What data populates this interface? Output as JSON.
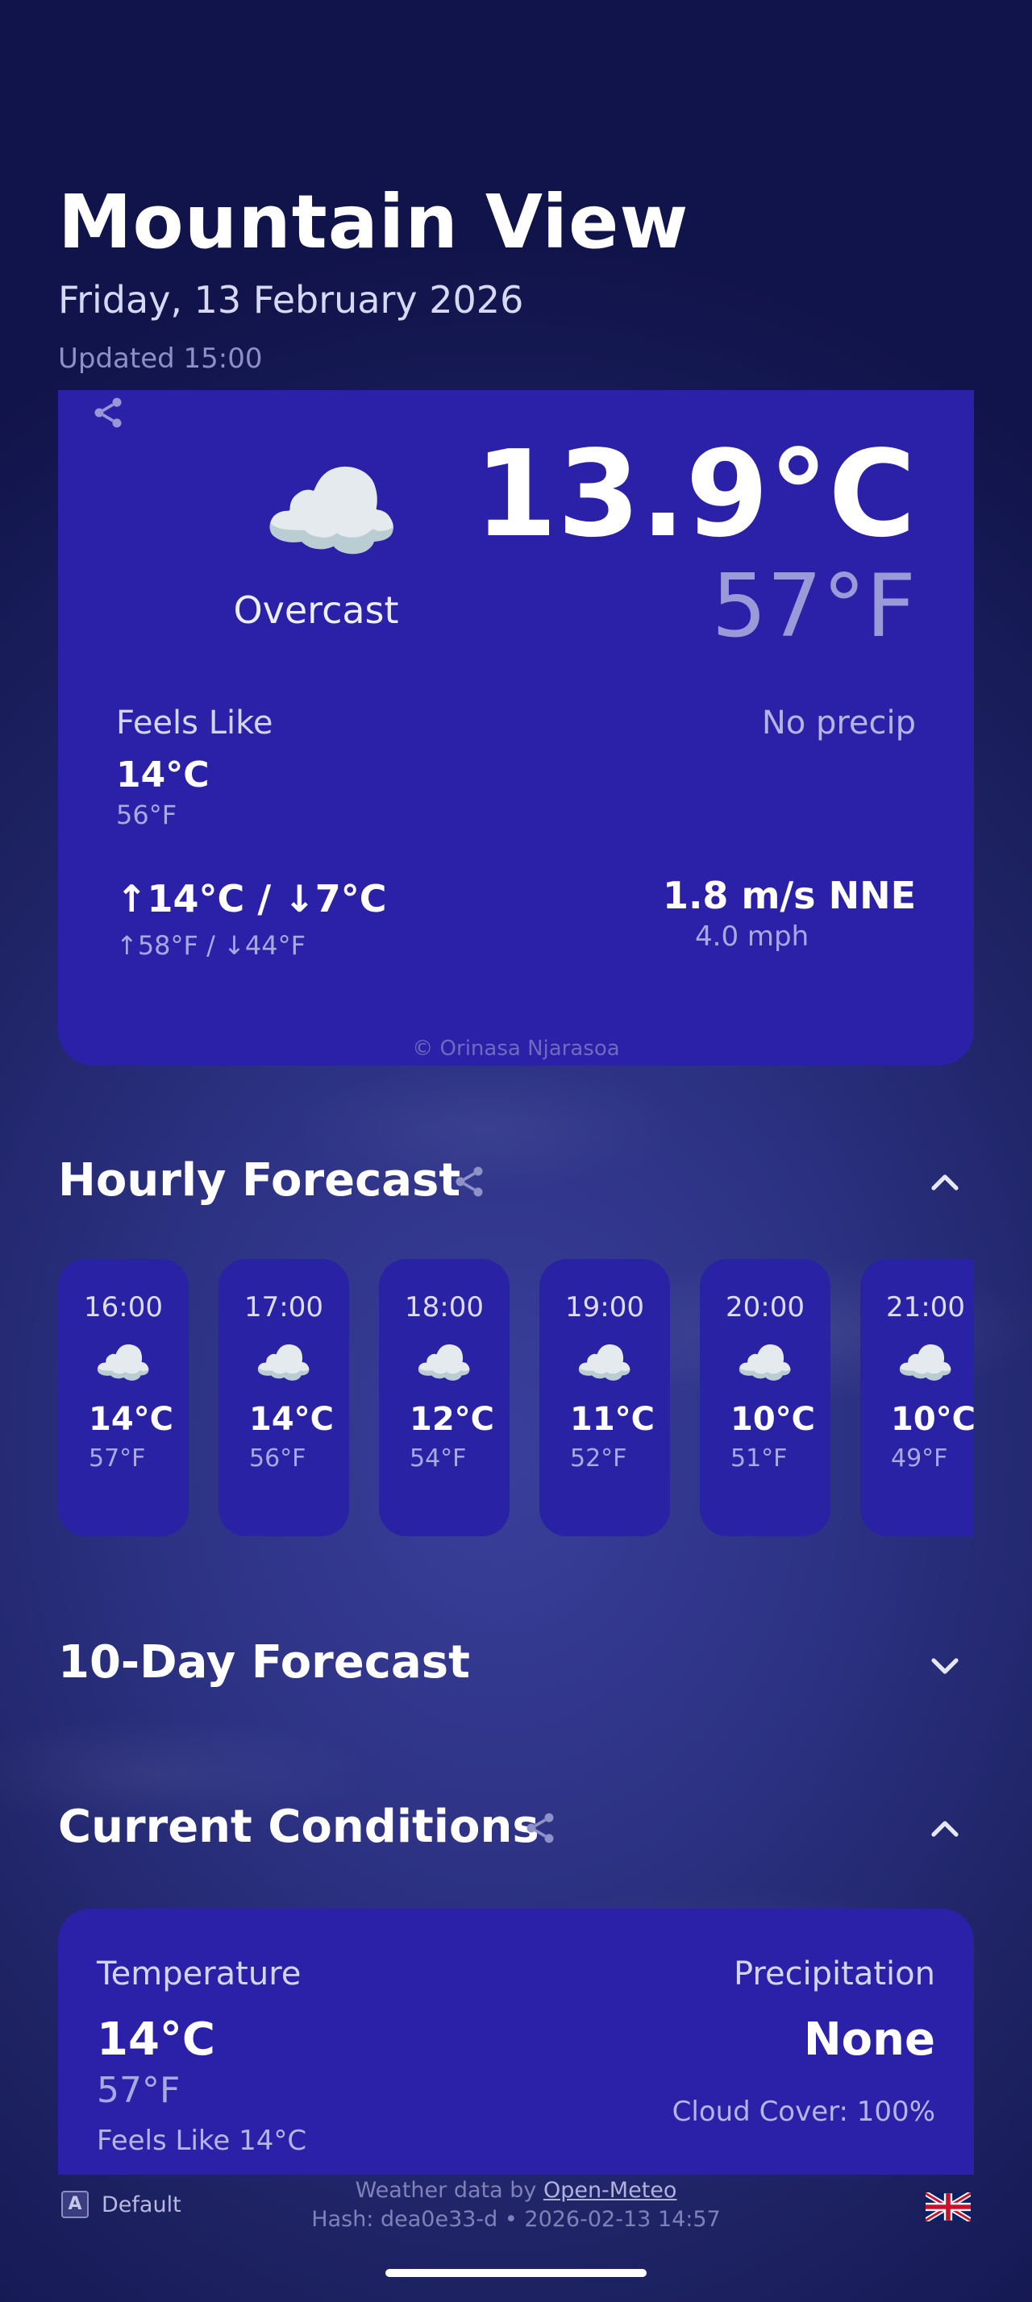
{
  "header": {
    "city": "Mountain View",
    "date": "Friday, 13 February 2026",
    "updated": "Updated 15:00"
  },
  "current": {
    "icon": "cloud-icon",
    "condition": "Overcast",
    "temp_c": "13.9°C",
    "temp_f": "57°F",
    "feels_like_label": "Feels Like",
    "feels_like_c": "14°C",
    "feels_like_f": "56°F",
    "precip": "No precip",
    "high_low_c": "↑14°C / ↓7°C",
    "high_low_f": "↑58°F / ↓44°F",
    "wind_ms": "1.8 m/s NNE",
    "wind_mph": "4.0 mph",
    "credit": "© Orinasa Njarasoa"
  },
  "hourly": {
    "title": "Hourly Forecast",
    "items": [
      {
        "time": "16:00",
        "c": "14°C",
        "f": "57°F"
      },
      {
        "time": "17:00",
        "c": "14°C",
        "f": "56°F"
      },
      {
        "time": "18:00",
        "c": "12°C",
        "f": "54°F"
      },
      {
        "time": "19:00",
        "c": "11°C",
        "f": "52°F"
      },
      {
        "time": "20:00",
        "c": "10°C",
        "f": "51°F"
      },
      {
        "time": "21:00",
        "c": "10°C",
        "f": "49°F"
      }
    ]
  },
  "ten_day": {
    "title": "10-Day Forecast"
  },
  "conditions": {
    "title": "Current Conditions",
    "temperature_label": "Temperature",
    "temperature_c": "14°C",
    "temperature_f": "57°F",
    "feels_like": "Feels Like 14°C",
    "precip_label": "Precipitation",
    "precip_value": "None",
    "cloud_cover": "Cloud Cover: 100%"
  },
  "footer": {
    "theme_icon_letter": "A",
    "theme_label": "Default",
    "data_prefix": "Weather data by ",
    "data_link": "Open-Meteo",
    "hash": "Hash: dea0e33-d • 2026-02-13 14:57",
    "language_icon": "uk-flag-icon"
  },
  "colors": {
    "card": "#2b21a8",
    "background": "#1f2466",
    "muted_text": "#a8a9e0"
  }
}
